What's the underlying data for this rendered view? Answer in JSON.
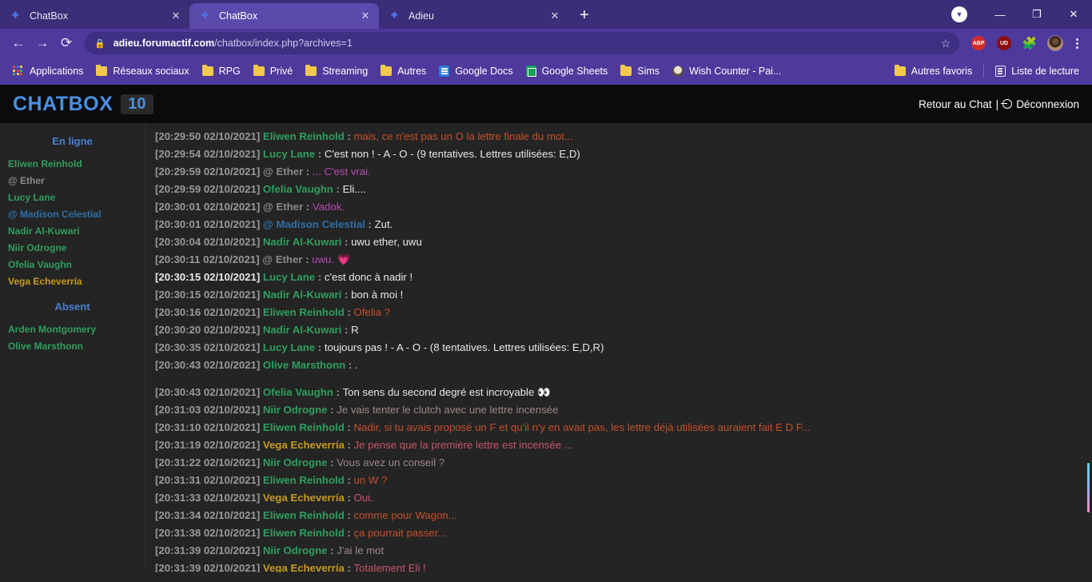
{
  "browser": {
    "tabs": [
      {
        "title": "ChatBox",
        "active": false,
        "favicon": "star-favicon",
        "close": "✕"
      },
      {
        "title": "ChatBox",
        "active": true,
        "favicon": "star-favicon",
        "close": "✕"
      },
      {
        "title": "Adieu",
        "active": false,
        "favicon": "star-favicon",
        "close": "✕"
      }
    ],
    "new_tab_label": "+",
    "window_controls": {
      "download": "▼",
      "minimize": "—",
      "maximize": "❐",
      "close": "✕"
    },
    "nav": {
      "back": "←",
      "forward": "→",
      "reload": "⟳"
    },
    "omnibox": {
      "lock_icon": "🔒",
      "url_domain": "adieu.forumactif.com",
      "url_path": "/chatbox/index.php?archives=1",
      "bookmark_star": "☆"
    },
    "extensions": [
      {
        "name": "adblock-plus-extension",
        "label": "ABP"
      },
      {
        "name": "ublock-extension",
        "label": "UD"
      },
      {
        "name": "extensions-puzzle-icon",
        "label": "🧩"
      }
    ],
    "menu_label": "⋮",
    "bookmarks": [
      {
        "label": "Applications",
        "icon": "apps-grid-icon"
      },
      {
        "label": "Réseaux sociaux",
        "icon": "folder-icon"
      },
      {
        "label": "RPG",
        "icon": "folder-icon"
      },
      {
        "label": "Privé",
        "icon": "folder-icon"
      },
      {
        "label": "Streaming",
        "icon": "folder-icon"
      },
      {
        "label": "Autres",
        "icon": "folder-icon"
      },
      {
        "label": "Google Docs",
        "icon": "google-docs-icon"
      },
      {
        "label": "Google Sheets",
        "icon": "google-sheets-icon"
      },
      {
        "label": "Sims",
        "icon": "folder-icon"
      },
      {
        "label": "Wish Counter - Pai...",
        "icon": "wish-counter-icon"
      }
    ],
    "bookmarks_right": [
      {
        "label": "Autres favoris",
        "icon": "folder-icon"
      },
      {
        "label": "Liste de lecture",
        "icon": "reading-list-icon"
      }
    ]
  },
  "chatbox": {
    "title": "CHATBOX",
    "count": "10",
    "back_link": "Retour au Chat",
    "separator": "|",
    "logout_link": "Déconnexion",
    "sidebar": {
      "online_header": "En ligne",
      "online_users": [
        {
          "name": "Eliwen Reinhold",
          "color": "#2f9e5e"
        },
        {
          "name": "@ Ether",
          "color": "#8a8a8a"
        },
        {
          "name": "Lucy Lane",
          "color": "#2f9e5e"
        },
        {
          "name": "@ Madison Celestial",
          "color": "#2f6fa8"
        },
        {
          "name": "Nadir Al-Kuwari",
          "color": "#2f9e5e"
        },
        {
          "name": "Niir Odrogne",
          "color": "#2f9e5e"
        },
        {
          "name": "Ofelia Vaughn",
          "color": "#2f9e5e"
        },
        {
          "name": "Vega Echeverría",
          "color": "#c79a1e"
        }
      ],
      "away_header": "Absent",
      "away_users": [
        {
          "name": "Arden Montgomery",
          "color": "#2f9e5e"
        },
        {
          "name": "Olive Marsthonn",
          "color": "#2f9e5e"
        }
      ]
    },
    "messages": [
      {
        "time": "[20:29:50 02/10/2021]",
        "nick": "Eliwen Reinhold",
        "nick_color": "#2f9e5e",
        "text": "mais, ce n'est pas un O la lettre finale du mot...",
        "text_color": "#c4502a"
      },
      {
        "time": "[20:29:54 02/10/2021]",
        "nick": "Lucy Lane",
        "nick_color": "#2f9e5e",
        "text": "C'est non ! - A - O - (9 tentatives. Lettres utilisées: E,D)",
        "text_color": "#e8e8e8"
      },
      {
        "time": "[20:29:59 02/10/2021]",
        "nick": "@ Ether",
        "nick_color": "#8a8a8a",
        "text": "... C'est vrai.",
        "text_color": "#b44ab4"
      },
      {
        "time": "[20:29:59 02/10/2021]",
        "nick": "Ofelia Vaughn",
        "nick_color": "#2f9e5e",
        "text": "Eli....",
        "text_color": "#e8e8e8"
      },
      {
        "time": "[20:30:01 02/10/2021]",
        "nick": "@ Ether",
        "nick_color": "#8a8a8a",
        "text": "Vadok.",
        "text_color": "#b44ab4"
      },
      {
        "time": "[20:30:01 02/10/2021]",
        "nick": "@ Madison Celestial",
        "nick_color": "#2f6fa8",
        "text": "Zut.",
        "text_color": "#e8e8e8"
      },
      {
        "time": "[20:30:04 02/10/2021]",
        "nick": "Nadir Al-Kuwari",
        "nick_color": "#2f9e5e",
        "text": "uwu ether, uwu",
        "text_color": "#e8e8e8"
      },
      {
        "time": "[20:30:11 02/10/2021]",
        "nick": "@ Ether",
        "nick_color": "#8a8a8a",
        "text": "uwu. 💗",
        "text_color": "#b44ab4"
      },
      {
        "time": "[20:30:15 02/10/2021]",
        "nick": "Lucy Lane",
        "nick_color": "#2f9e5e",
        "text": "c'est donc à nadir !",
        "text_color": "#e8e8e8",
        "time_highlight": true
      },
      {
        "time": "[20:30:15 02/10/2021]",
        "nick": "Nadir Al-Kuwari",
        "nick_color": "#2f9e5e",
        "text": "bon à moi !",
        "text_color": "#e8e8e8"
      },
      {
        "time": "[20:30:16 02/10/2021]",
        "nick": "Eliwen Reinhold",
        "nick_color": "#2f9e5e",
        "text": "Ofelia ?",
        "text_color": "#c4502a"
      },
      {
        "time": "[20:30:20 02/10/2021]",
        "nick": "Nadir Al-Kuwari",
        "nick_color": "#2f9e5e",
        "text": "R",
        "text_color": "#e8e8e8"
      },
      {
        "time": "[20:30:35 02/10/2021]",
        "nick": "Lucy Lane",
        "nick_color": "#2f9e5e",
        "text": "toujours pas ! - A - O - (8 tentatives. Lettres utilisées: E,D,R)",
        "text_color": "#e8e8e8"
      },
      {
        "time": "[20:30:43 02/10/2021]",
        "nick": "Olive Marsthonn",
        "nick_color": "#2f9e5e",
        "text": ".",
        "text_color": "#e8e8e8"
      },
      {
        "time": "[20:30:43 02/10/2021]",
        "nick": "Ofelia Vaughn",
        "nick_color": "#2f9e5e",
        "text": "Ton sens du second degré est incroyable 👀",
        "text_color": "#e8e8e8",
        "gap_before": true
      },
      {
        "time": "[20:31:03 02/10/2021]",
        "nick": "Niir Odrogne",
        "nick_color": "#2f9e5e",
        "text": "Je vais tenter le clutch avec une lettre incensée",
        "text_color": "#9c8a86"
      },
      {
        "time": "[20:31:10 02/10/2021]",
        "nick": "Eliwen Reinhold",
        "nick_color": "#2f9e5e",
        "text": "Nadir, si tu avais proposé un F et qu'il n'y en avait pas, les lettre déjà utilisées auraient fait E D F...",
        "text_color": "#c4502a"
      },
      {
        "time": "[20:31:19 02/10/2021]",
        "nick": "Vega Echeverría",
        "nick_color": "#c79a1e",
        "text": "Je pense que la première lettre est incensée ...",
        "text_color": "#c4576a"
      },
      {
        "time": "[20:31:22 02/10/2021]",
        "nick": "Niir Odrogne",
        "nick_color": "#2f9e5e",
        "text": "Vous avez un conseil ?",
        "text_color": "#9c8a86"
      },
      {
        "time": "[20:31:31 02/10/2021]",
        "nick": "Eliwen Reinhold",
        "nick_color": "#2f9e5e",
        "text": "un W ?",
        "text_color": "#c4502a"
      },
      {
        "time": "[20:31:33 02/10/2021]",
        "nick": "Vega Echeverría",
        "nick_color": "#c79a1e",
        "text": "Oui.",
        "text_color": "#c4576a"
      },
      {
        "time": "[20:31:34 02/10/2021]",
        "nick": "Eliwen Reinhold",
        "nick_color": "#2f9e5e",
        "text": "comme pour Wagon...",
        "text_color": "#c4502a"
      },
      {
        "time": "[20:31:38 02/10/2021]",
        "nick": "Eliwen Reinhold",
        "nick_color": "#2f9e5e",
        "text": "ça pourrait passer...",
        "text_color": "#c4502a"
      },
      {
        "time": "[20:31:39 02/10/2021]",
        "nick": "Niir Odrogne",
        "nick_color": "#2f9e5e",
        "text": "J'ai le mot",
        "text_color": "#9c8a86"
      },
      {
        "time": "[20:31:39 02/10/2021]",
        "nick": "Vega Echeverría",
        "nick_color": "#c79a1e",
        "text": "Totalement Eli !",
        "text_color": "#c4576a",
        "clipped": true
      }
    ]
  }
}
